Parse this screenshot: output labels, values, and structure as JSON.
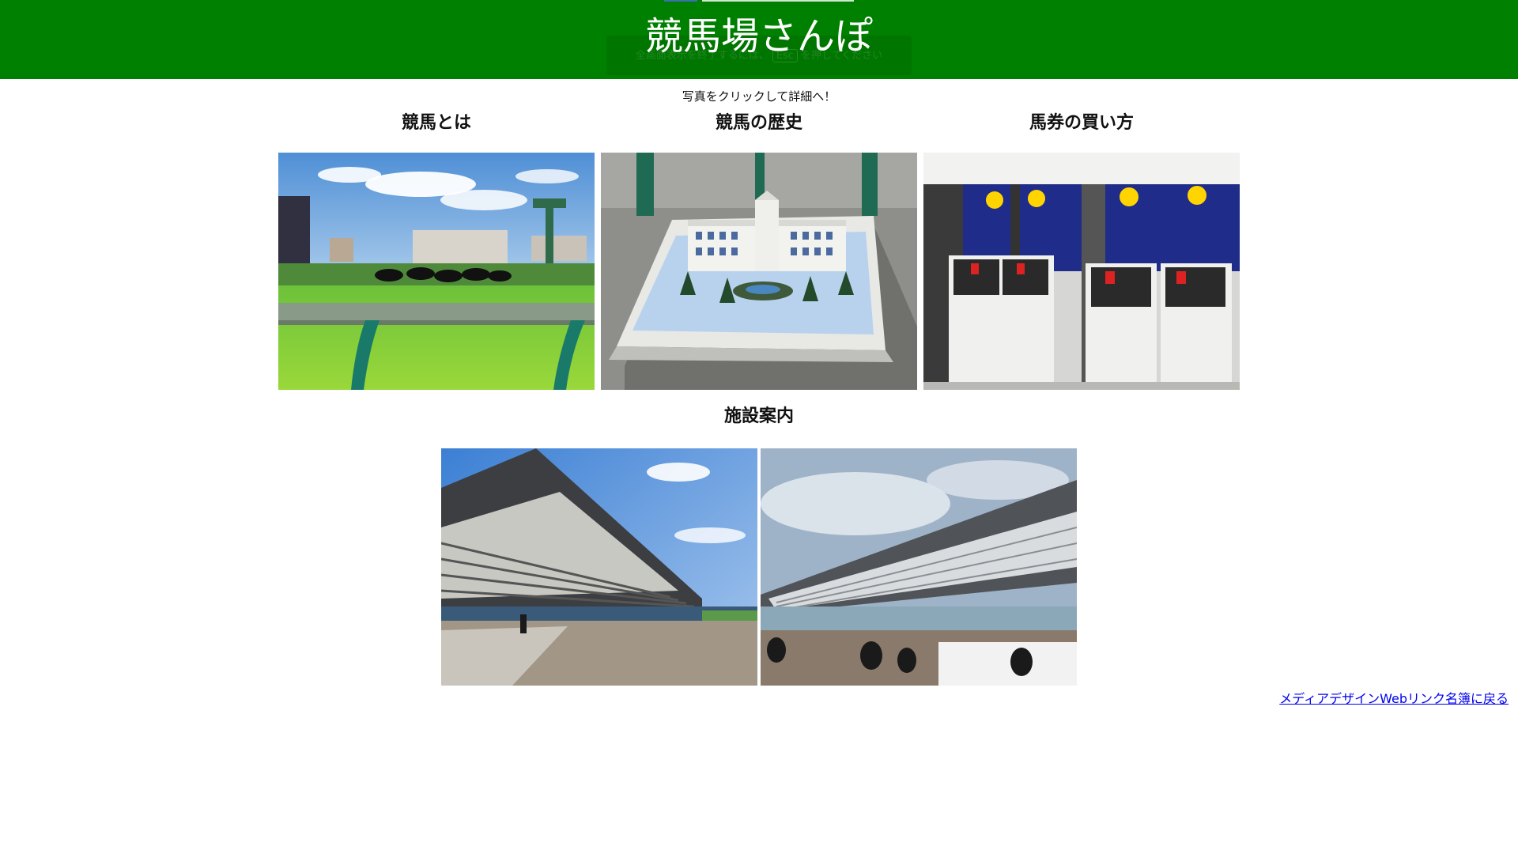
{
  "header": {
    "title": "競馬場さんぽ",
    "background_color": "#008000"
  },
  "fullscreen_toast": {
    "text_before": "全画面表示を終了するには、",
    "key": "Esc",
    "text_after": "を押してください"
  },
  "intro_text": "写真をクリックして詳細へ！",
  "sections": [
    {
      "title": "競馬とは",
      "photo_icon": "racetrack-photo"
    },
    {
      "title": "競馬の歴史",
      "photo_icon": "grandstand-model-photo"
    },
    {
      "title": "馬券の買い方",
      "photo_icon": "ticket-machines-photo"
    },
    {
      "title": "施設案内",
      "photo_icons": [
        "grandstand-sunny-photo",
        "grandstand-cloudy-photo"
      ]
    }
  ],
  "footer": {
    "back_link": "メディアデザインWebリンク名簿に戻る"
  }
}
